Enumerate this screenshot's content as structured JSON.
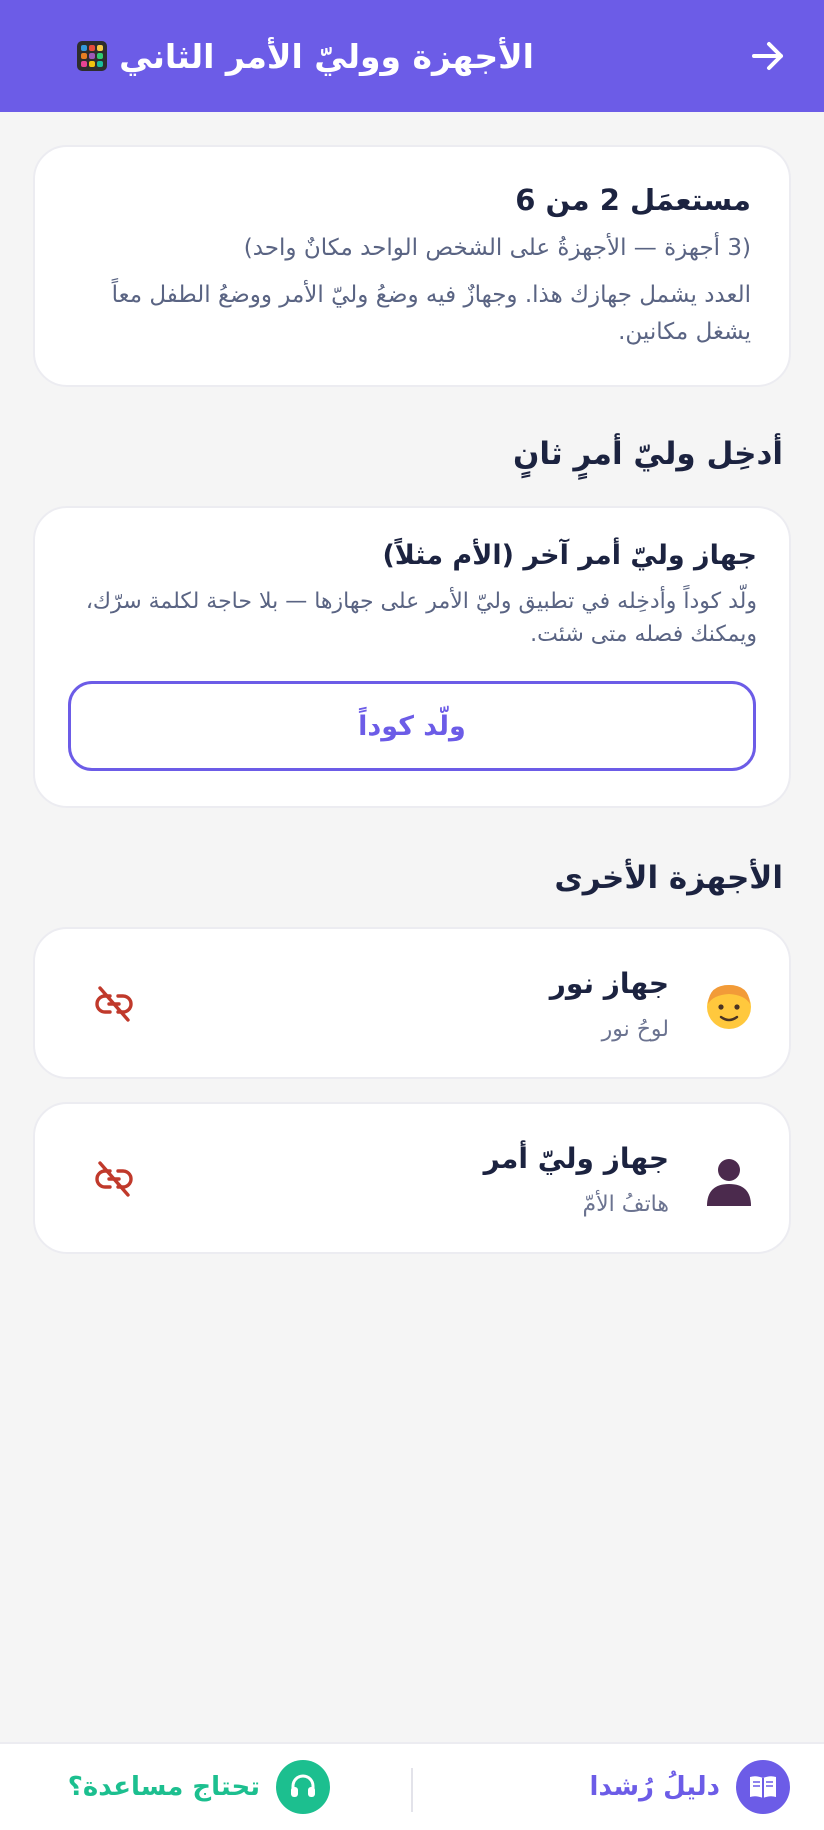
{
  "colors": {
    "primary": "#6c5ce7",
    "header_bg": "#6c5ce7",
    "help_green": "#1cbf8f",
    "danger_red": "#c0392b",
    "text_dark": "#1c2340",
    "text_muted": "#5a6483"
  },
  "header": {
    "title": "الأجهزة ووليّ الأمر الثاني",
    "title_icon": "devices-grid-icon",
    "back_icon": "arrow-right-icon"
  },
  "usage": {
    "heading": "مستعمَل 2 من 6",
    "note": "(3 أجهزة — الأجهزةُ على الشخص الواحد مكانٌ واحد)",
    "description": "العدد يشمل جهازك هذا. وجهازٌ فيه وضعُ وليّ الأمر ووضعُ الطفل معاً يشغل مكانين."
  },
  "invite": {
    "section_title": "أدخِل وليّ أمرٍ ثانٍ",
    "heading": "جهاز وليّ أمر آخر (الأم مثلاً)",
    "description": "ولّد كوداً وأدخِله في تطبيق وليّ الأمر على جهازها — بلا حاجة لكلمة سرّك، ويمكنك فصله متى شئت.",
    "button_label": "ولّد كوداً"
  },
  "devices": {
    "section_title": "الأجهزة الأخرى",
    "items": [
      {
        "name": "جهاز نور",
        "subtitle": "لوحُ نور",
        "avatar": "child-face-icon",
        "action_icon": "unlink-icon"
      },
      {
        "name": "جهاز وليّ أمر",
        "subtitle": "هاتفُ الأمّ",
        "avatar": "person-silhouette-icon",
        "action_icon": "unlink-icon"
      }
    ]
  },
  "bottom_bar": {
    "guide_label": "دليلُ رُشدا",
    "guide_icon": "book-icon",
    "help_label": "تحتاج مساعدة؟",
    "help_icon": "headset-icon"
  }
}
